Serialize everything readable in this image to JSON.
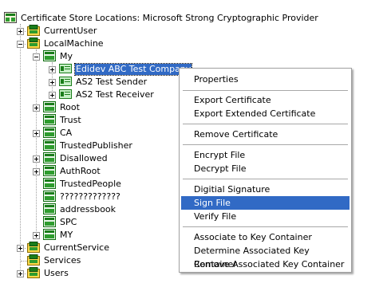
{
  "tree": {
    "root_label": "Certificate Store Locations: Microsoft Strong Cryptographic Provider",
    "current_user": "CurrentUser",
    "local_machine": "LocalMachine",
    "my": "My",
    "cert1": "Edidev ABC Test Company",
    "cert2": "AS2 Test Sender",
    "cert3": "AS2 Test Receiver",
    "stores": [
      "Root",
      "Trust",
      "CA",
      "TrustedPublisher",
      "Disallowed",
      "AuthRoot",
      "TrustedPeople",
      "?????????????",
      "addressbook",
      "SPC",
      "MY"
    ],
    "current_service": "CurrentService",
    "services": "Services",
    "users": "Users"
  },
  "context_menu": {
    "properties": "Properties",
    "export_certificate": "Export Certificate",
    "export_extended_certificate": "Export Extended Certificate",
    "remove_certificate": "Remove Certificate",
    "encrypt_file": "Encrypt File",
    "decrypt_file": "Decrypt File",
    "digital_signature": "Digitial Signature",
    "sign_file": "Sign File",
    "verify_file": "Verify File",
    "associate_key_container": "Associate to Key Container",
    "determine_key_container": "Determine Associated Key Container",
    "remove_key_container": "Remove Associated Key Container"
  },
  "colors": {
    "selection": "#316ac5",
    "store_icon": "#1a7d1a",
    "cert_icon": "#3aa03a"
  }
}
